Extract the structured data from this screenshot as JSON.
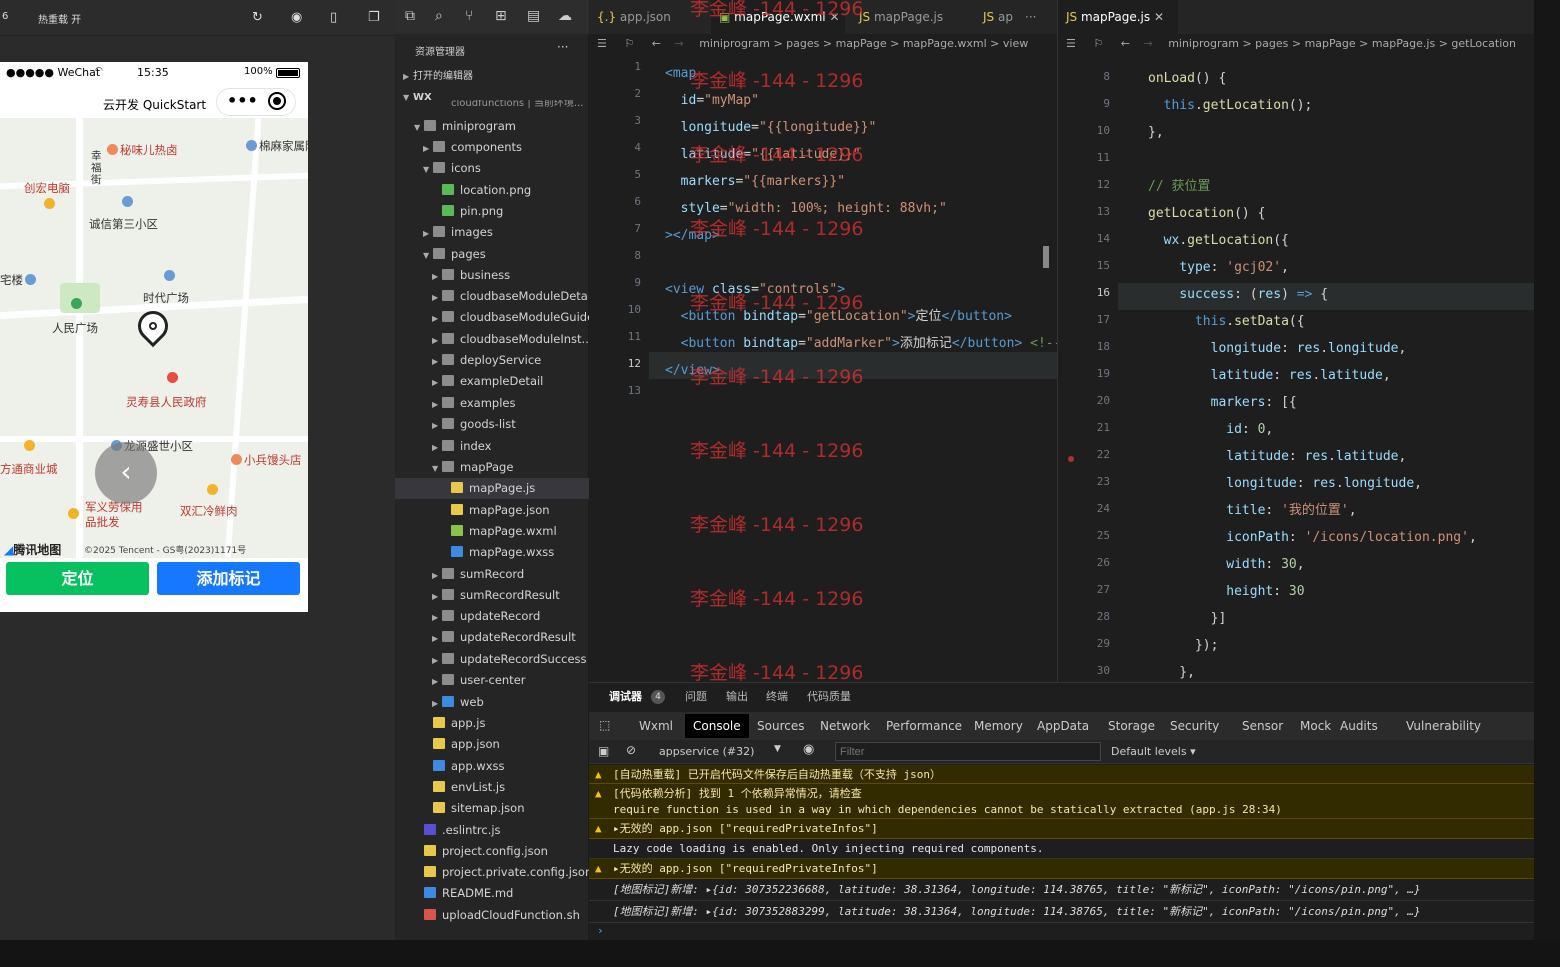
{
  "simulator": {
    "topbar": {
      "left_num": "6",
      "hot_reload": "热重载 开"
    },
    "phone": {
      "carrier": "●●●●● WeChat",
      "time": "15:35",
      "battery": "100%",
      "title": "云开发 QuickStart"
    },
    "map": {
      "pois": [
        "秘味儿热卤",
        "棉麻家属院",
        "幸福街",
        "创宏电脑",
        "诚信第三小区",
        "时代广场",
        "人民广场",
        "灵寿县人民政府",
        "龙源盛世小区",
        "小兵馒头店",
        "方通商业城",
        "军义劳保用品批发",
        "双汇冷鲜肉",
        "宅楼"
      ],
      "provider": "腾讯地图",
      "copyright": "©2025 Tencent - GS粤(2023)1171号"
    },
    "buttons": {
      "locate": "定位",
      "add_marker": "添加标记"
    }
  },
  "explorer": {
    "title": "资源管理器",
    "more": "···",
    "open_editors": "打开的编辑器",
    "root": "WX",
    "cut_row": "cloudfunctions | 当前环境...",
    "items": [
      {
        "label": "miniprogram",
        "depth": 1,
        "kind": "folder-open"
      },
      {
        "label": "components",
        "depth": 2,
        "kind": "folder"
      },
      {
        "label": "icons",
        "depth": 2,
        "kind": "folder-open"
      },
      {
        "label": "location.png",
        "depth": 3,
        "kind": "image"
      },
      {
        "label": "pin.png",
        "depth": 3,
        "kind": "image"
      },
      {
        "label": "images",
        "depth": 2,
        "kind": "folder"
      },
      {
        "label": "pages",
        "depth": 2,
        "kind": "folder-open"
      },
      {
        "label": "business",
        "depth": 3,
        "kind": "folder"
      },
      {
        "label": "cloudbaseModuleDetail",
        "depth": 3,
        "kind": "folder"
      },
      {
        "label": "cloudbaseModuleGuide",
        "depth": 3,
        "kind": "folder"
      },
      {
        "label": "cloudbaseModuleInst...",
        "depth": 3,
        "kind": "folder"
      },
      {
        "label": "deployService",
        "depth": 3,
        "kind": "folder"
      },
      {
        "label": "exampleDetail",
        "depth": 3,
        "kind": "folder"
      },
      {
        "label": "examples",
        "depth": 3,
        "kind": "folder"
      },
      {
        "label": "goods-list",
        "depth": 3,
        "kind": "folder"
      },
      {
        "label": "index",
        "depth": 3,
        "kind": "folder"
      },
      {
        "label": "mapPage",
        "depth": 3,
        "kind": "folder-open"
      },
      {
        "label": "mapPage.js",
        "depth": 4,
        "kind": "js"
      },
      {
        "label": "mapPage.json",
        "depth": 4,
        "kind": "json"
      },
      {
        "label": "mapPage.wxml",
        "depth": 4,
        "kind": "wxml"
      },
      {
        "label": "mapPage.wxss",
        "depth": 4,
        "kind": "wxss"
      },
      {
        "label": "sumRecord",
        "depth": 3,
        "kind": "folder"
      },
      {
        "label": "sumRecordResult",
        "depth": 3,
        "kind": "folder"
      },
      {
        "label": "updateRecord",
        "depth": 3,
        "kind": "folder"
      },
      {
        "label": "updateRecordResult",
        "depth": 3,
        "kind": "folder"
      },
      {
        "label": "updateRecordSuccess",
        "depth": 3,
        "kind": "folder"
      },
      {
        "label": "user-center",
        "depth": 3,
        "kind": "folder"
      },
      {
        "label": "web",
        "depth": 3,
        "kind": "folder-web"
      },
      {
        "label": "app.js",
        "depth": 2,
        "kind": "js"
      },
      {
        "label": "app.json",
        "depth": 2,
        "kind": "json"
      },
      {
        "label": "app.wxss",
        "depth": 2,
        "kind": "wxss"
      },
      {
        "label": "envList.js",
        "depth": 2,
        "kind": "js"
      },
      {
        "label": "sitemap.json",
        "depth": 2,
        "kind": "json"
      },
      {
        "label": ".eslintrc.js",
        "depth": 1,
        "kind": "eslint"
      },
      {
        "label": "project.config.json",
        "depth": 1,
        "kind": "json"
      },
      {
        "label": "project.private.config.json",
        "depth": 1,
        "kind": "json"
      },
      {
        "label": "README.md",
        "depth": 1,
        "kind": "info"
      },
      {
        "label": "uploadCloudFunction.sh",
        "depth": 1,
        "kind": "sh"
      }
    ]
  },
  "editor1": {
    "tabs": [
      "app.json",
      "mapPage.wxml",
      "mapPage.js",
      "ap",
      "···"
    ],
    "breadcrumb": "miniprogram  >  pages  >  mapPage  >  mapPage.wxml  >  view",
    "line_numbers": [
      "1",
      "2",
      "3",
      "4",
      "5",
      "6",
      "7",
      "8",
      "9",
      "10",
      "11",
      "12",
      "13"
    ]
  },
  "editor2": {
    "tab": "mapPage.js",
    "breadcrumb": "miniprogram  >  pages  >  mapPage  >  mapPage.js  >  getLocation",
    "line_numbers": [
      "8",
      "9",
      "10",
      "11",
      "12",
      "13",
      "14",
      "15",
      "16",
      "17",
      "18",
      "19",
      "20",
      "21",
      "22",
      "23",
      "24",
      "25",
      "26",
      "27",
      "28",
      "29",
      "30"
    ]
  },
  "watermark": "李金峰 -144 - 1296",
  "devtools": {
    "tabs": [
      "调试器",
      "4",
      "问题",
      "输出",
      "终端",
      "代码质量"
    ],
    "console_tabs": [
      "Wxml",
      "Console",
      "Sources",
      "Network",
      "Performance",
      "Memory",
      "AppData",
      "Storage",
      "Security",
      "Sensor",
      "Mock",
      "Audits",
      "Vulnerability"
    ],
    "context": "appservice (#32)",
    "filter_placeholder": "Filter",
    "levels": "Default levels ▾",
    "logs": [
      "[自动热重载] 已开启代码文件保存后自动热重载（不支持 json）",
      "[代码依赖分析] 找到 1 个依赖异常情况，请检查",
      "require function is used in a way in which dependencies cannot be statically extracted (app.js 28:34)",
      "▸无效的 app.json [\"requiredPrivateInfos\"]",
      "Lazy code loading is enabled. Only injecting required components.",
      "▸无效的 app.json [\"requiredPrivateInfos\"]",
      "[地图标记]新增: ▸{id: 307352236688, latitude: 38.31364, longitude: 114.38765, title: \"新标记\", iconPath: \"/icons/pin.png\", …}",
      "[地图标记]新增: ▸{id: 307352883299, latitude: 38.31364, longitude: 114.38765, title: \"新标记\", iconPath: \"/icons/pin.png\", …}",
      "›"
    ]
  }
}
